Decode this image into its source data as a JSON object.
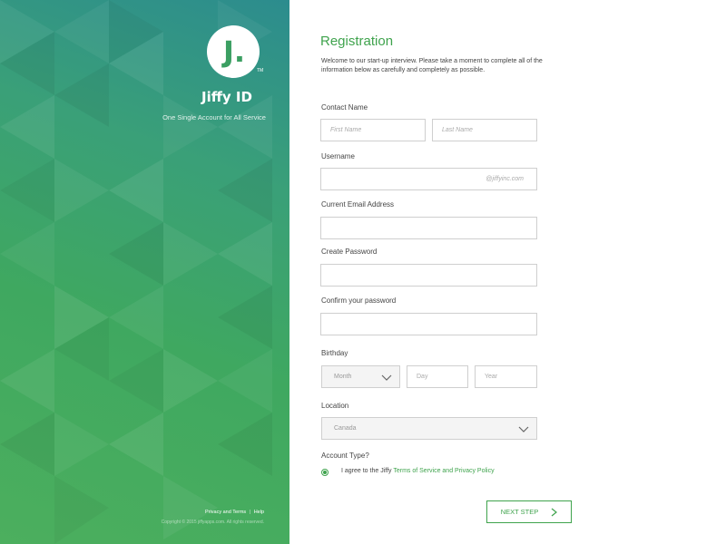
{
  "brand": {
    "logo_letter": "J.",
    "trademark": "TM",
    "name": "Jiffy ID",
    "tagline": "One Single Account for All Service"
  },
  "footer": {
    "privacy": "Privacy and Terms",
    "separator": "|",
    "help": "Help",
    "copyright": "Copyright © 2015 jiffyapps.com. All rights reserved."
  },
  "form": {
    "title": "Registration",
    "intro": "Welcome to our start-up interview. Please take a moment to complete all of the information below as carefully and completely as possible.",
    "contact_label": "Contact Name",
    "first_name_placeholder": "First Name",
    "last_name_placeholder": "Last Name",
    "username_label": "Username",
    "username_suffix": "@jiffyinc.com",
    "email_label": "Current Email Address",
    "password_label": "Create Password",
    "confirm_label": "Confirm your password",
    "birthday_label": "Birthday",
    "month_value": "Month",
    "day_placeholder": "Day",
    "year_placeholder": "Year",
    "location_label": "Location",
    "location_value": "Canada",
    "account_type_label": "Account Type?",
    "agree_text": "I agree to the Jiffy ",
    "agree_link": "Terms of Service and Privacy Policy",
    "next_label": "NEXT STEP"
  },
  "colors": {
    "accent": "#3fa34d",
    "panel_top": "#2c8c8e",
    "panel_bottom": "#4caf5e"
  }
}
